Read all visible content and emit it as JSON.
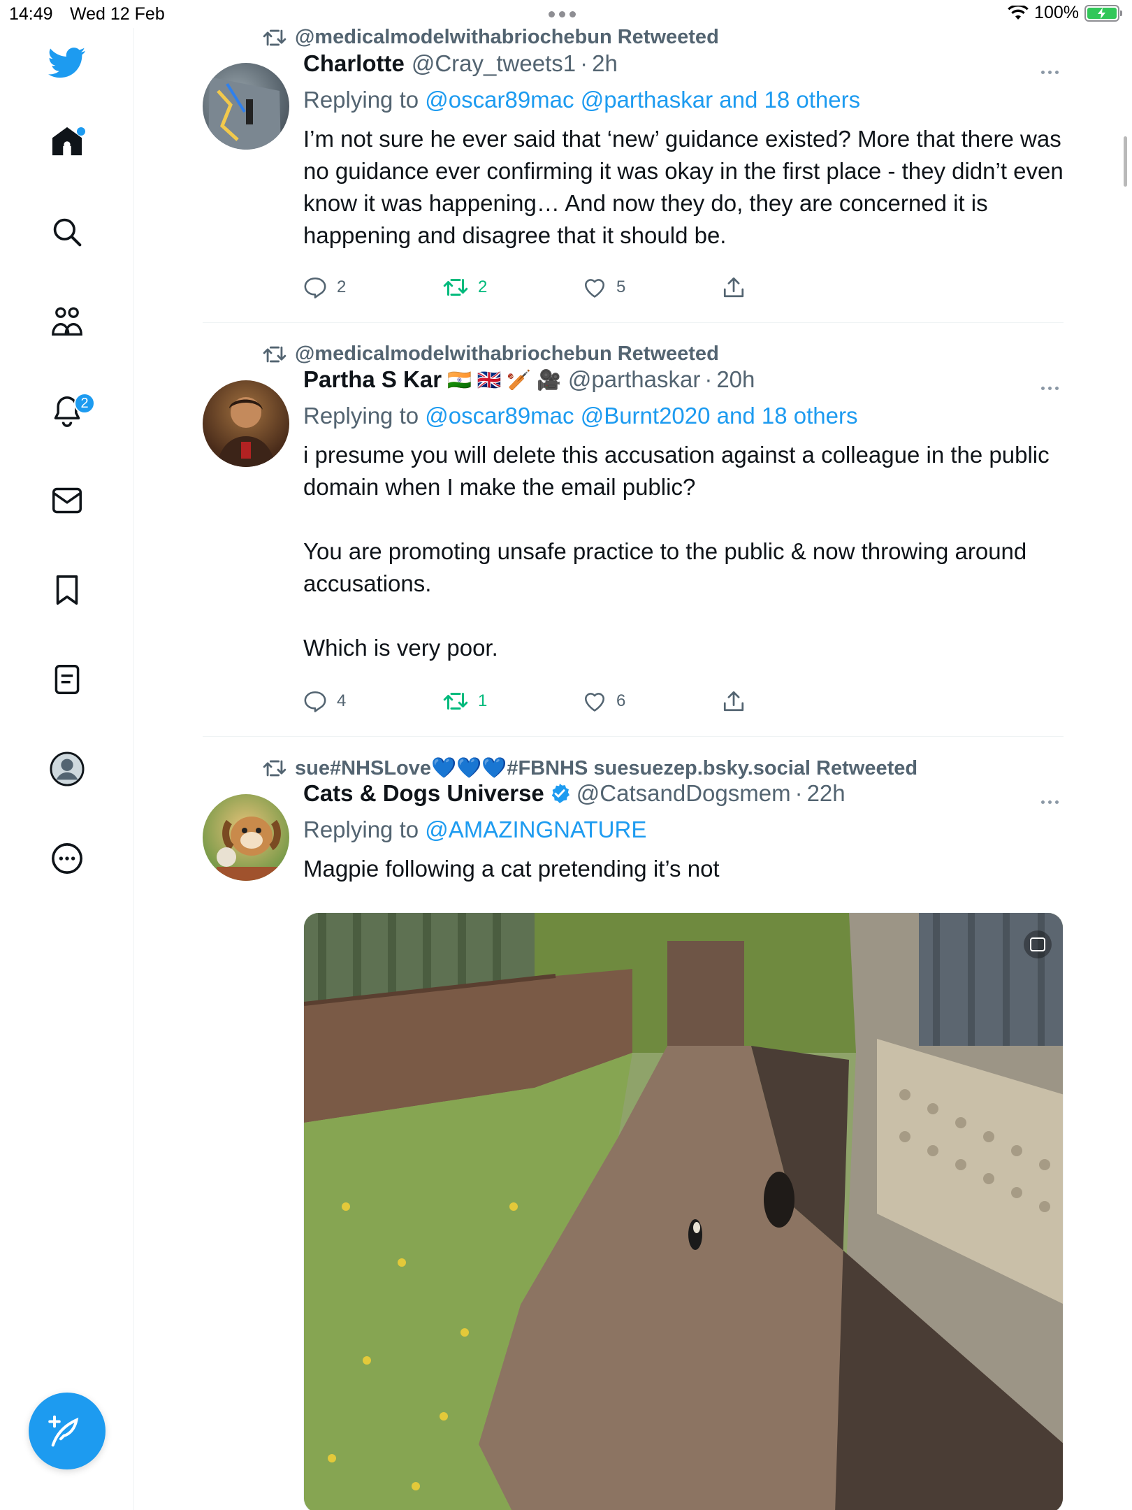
{
  "status_bar": {
    "time": "14:49",
    "date": "Wed 12 Feb",
    "battery": "100%"
  },
  "sidebar": {
    "items": [
      {
        "icon": "twitter-logo-icon"
      },
      {
        "icon": "home-icon"
      },
      {
        "icon": "search-icon"
      },
      {
        "icon": "communities-icon"
      },
      {
        "icon": "notifications-bell-icon",
        "badge": "2"
      },
      {
        "icon": "messages-envelope-icon"
      },
      {
        "icon": "bookmark-icon"
      },
      {
        "icon": "lists-icon"
      },
      {
        "icon": "profile-icon"
      },
      {
        "icon": "more-circle-icon"
      }
    ],
    "compose": {
      "icon": "compose-feather-icon"
    }
  },
  "colors": {
    "accent": "#1d9bf0",
    "retweet": "#00ba7c",
    "secondary_text": "#536471"
  },
  "tweets": [
    {
      "retweeted_by": "@medicalmodelwithabriochebun Retweeted",
      "name": "Charlotte",
      "handle": "@Cray_tweets1",
      "time": "2h",
      "replying_prefix": "Replying to",
      "replying_links": "@oscar89mac @parthaskar and 18 others",
      "text": "I’m not sure he ever said that ‘new’ guidance existed? More that there was no guidance ever confirming it was okay in the first place - they didn’t even know it was happening… And now they do, they are concerned it is happening and disagree that it should be.",
      "replies": "2",
      "retweets": "2",
      "likes": "5"
    },
    {
      "retweeted_by": "@medicalmodelwithabriochebun Retweeted",
      "name": "Partha S Kar",
      "name_emoji": "🇮🇳 🇬🇧 🏏 🎥",
      "handle": "@parthaskar",
      "time": "20h",
      "replying_prefix": "Replying to",
      "replying_links": "@oscar89mac @Burnt2020 and 18 others",
      "text": "i presume you will delete this accusation against a colleague in the public domain when I make the email public?\n\nYou are promoting unsafe practice to the public & now throwing around accusations.\n\nWhich is very poor.",
      "replies": "4",
      "retweets": "1",
      "likes": "6"
    },
    {
      "retweeted_by": "sue#NHSLove💙💙💙#FBNHS suesuezep.bsky.social Retweeted",
      "name": "Cats & Dogs Universe",
      "handle": "@CatsandDogsmem",
      "time": "22h",
      "replying_prefix": "Replying to",
      "replying_links": "@AMAZINGNATURE",
      "text": "Magpie following a cat pretending it’s not"
    }
  ],
  "sep": "·"
}
